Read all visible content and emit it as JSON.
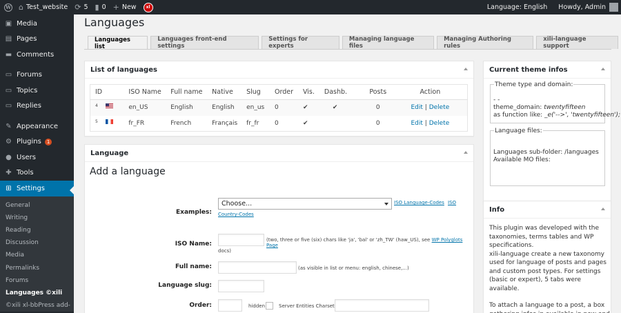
{
  "admin_bar": {
    "site_name": "Test_website",
    "updates_count": "5",
    "comments_count": "0",
    "new_label": "New",
    "language": "Language: English",
    "howdy": "Howdy, Admin"
  },
  "menu": {
    "items": [
      {
        "label": "Media",
        "icon": "media-icon"
      },
      {
        "label": "Pages",
        "icon": "pages-icon"
      },
      {
        "label": "Comments",
        "icon": "comments-icon"
      },
      {
        "label": "Forums",
        "icon": "forums-icon"
      },
      {
        "label": "Topics",
        "icon": "topics-icon"
      },
      {
        "label": "Replies",
        "icon": "replies-icon"
      },
      {
        "label": "Appearance",
        "icon": "appearance-icon"
      },
      {
        "label": "Plugins",
        "icon": "plugins-icon",
        "badge": "1"
      },
      {
        "label": "Users",
        "icon": "users-icon"
      },
      {
        "label": "Tools",
        "icon": "tools-icon"
      },
      {
        "label": "Settings",
        "icon": "settings-icon"
      }
    ],
    "submenu": [
      "General",
      "Writing",
      "Reading",
      "Discussion",
      "Media",
      "Permalinks",
      "Forums",
      "Languages ©xili",
      "©xili xl-bbPress add-"
    ]
  },
  "page_title": "Languages",
  "tabs": [
    "Languages list",
    "Languages front-end settings",
    "Settings for experts",
    "Managing language files",
    "Managing Authoring rules",
    "xili-language support"
  ],
  "list_box": {
    "title": "List of languages",
    "columns": [
      "ID",
      "ISO Name",
      "Full name",
      "Native",
      "Slug",
      "Order",
      "Vis.",
      "Dashb.",
      "Posts",
      "Action"
    ],
    "rows": [
      {
        "id": "4",
        "flag": "us",
        "iso": "en_US",
        "full": "English",
        "native": "English",
        "slug": "en_us",
        "order": "0",
        "vis": "✔",
        "dashb": "✔",
        "posts": "0",
        "edit": "Edit",
        "sep": "|",
        "delete": "Delete"
      },
      {
        "id": "5",
        "flag": "fr",
        "iso": "fr_FR",
        "full": "French",
        "native": "Français",
        "slug": "fr_fr",
        "order": "0",
        "vis": "✔",
        "dashb": "",
        "posts": "0",
        "edit": "Edit",
        "sep": "|",
        "delete": "Delete"
      }
    ]
  },
  "language_box": {
    "title": "Language",
    "heading": "Add a language",
    "examples_label": "Examples:",
    "examples_value": "Choose...",
    "iso_codes_link": "ISO Language-Codes",
    "country_codes_link": "ISO",
    "country_codes_link2": "Country-Codes",
    "iso_label": "ISO Name:",
    "iso_hint": "(two, three or five (six) chars like 'ja', 'bal' or 'zh_TW' (haw_US), see",
    "iso_hint_link": "WP Polyglots Page",
    "iso_hint_end": "docs)",
    "full_label": "Full name:",
    "full_hint": "(as visible in list or menu: english, chinese,...)",
    "slug_label": "Language slug:",
    "order_label": "Order:",
    "hidden_label": "hidden",
    "charset_label": "Server Entities Charset:"
  },
  "theme_box": {
    "title": "Current theme infos",
    "type_legend": "Theme type and domain:",
    "dashes": "- -",
    "domain_label": "theme_domain:",
    "domain_value": "twentyfifteen",
    "function_label": "as function like:",
    "function_value": "_e('-->', 'twentyfifteen');",
    "files_legend": "Language files:",
    "subfolder": "Languages sub-folder: /languages",
    "mo_files": "Available MO files:"
  },
  "info_box": {
    "title": "Info",
    "text1": "This plugin was developed with the taxonomies, terms tables and WP specifications.",
    "text2": "xili-language create a new taxonomy used for language of posts and pages and custom post types. For settings (basic or expert), 5 tabs were available.",
    "text3": "To attach a language to a post, a box gathering infos in available in new and"
  }
}
